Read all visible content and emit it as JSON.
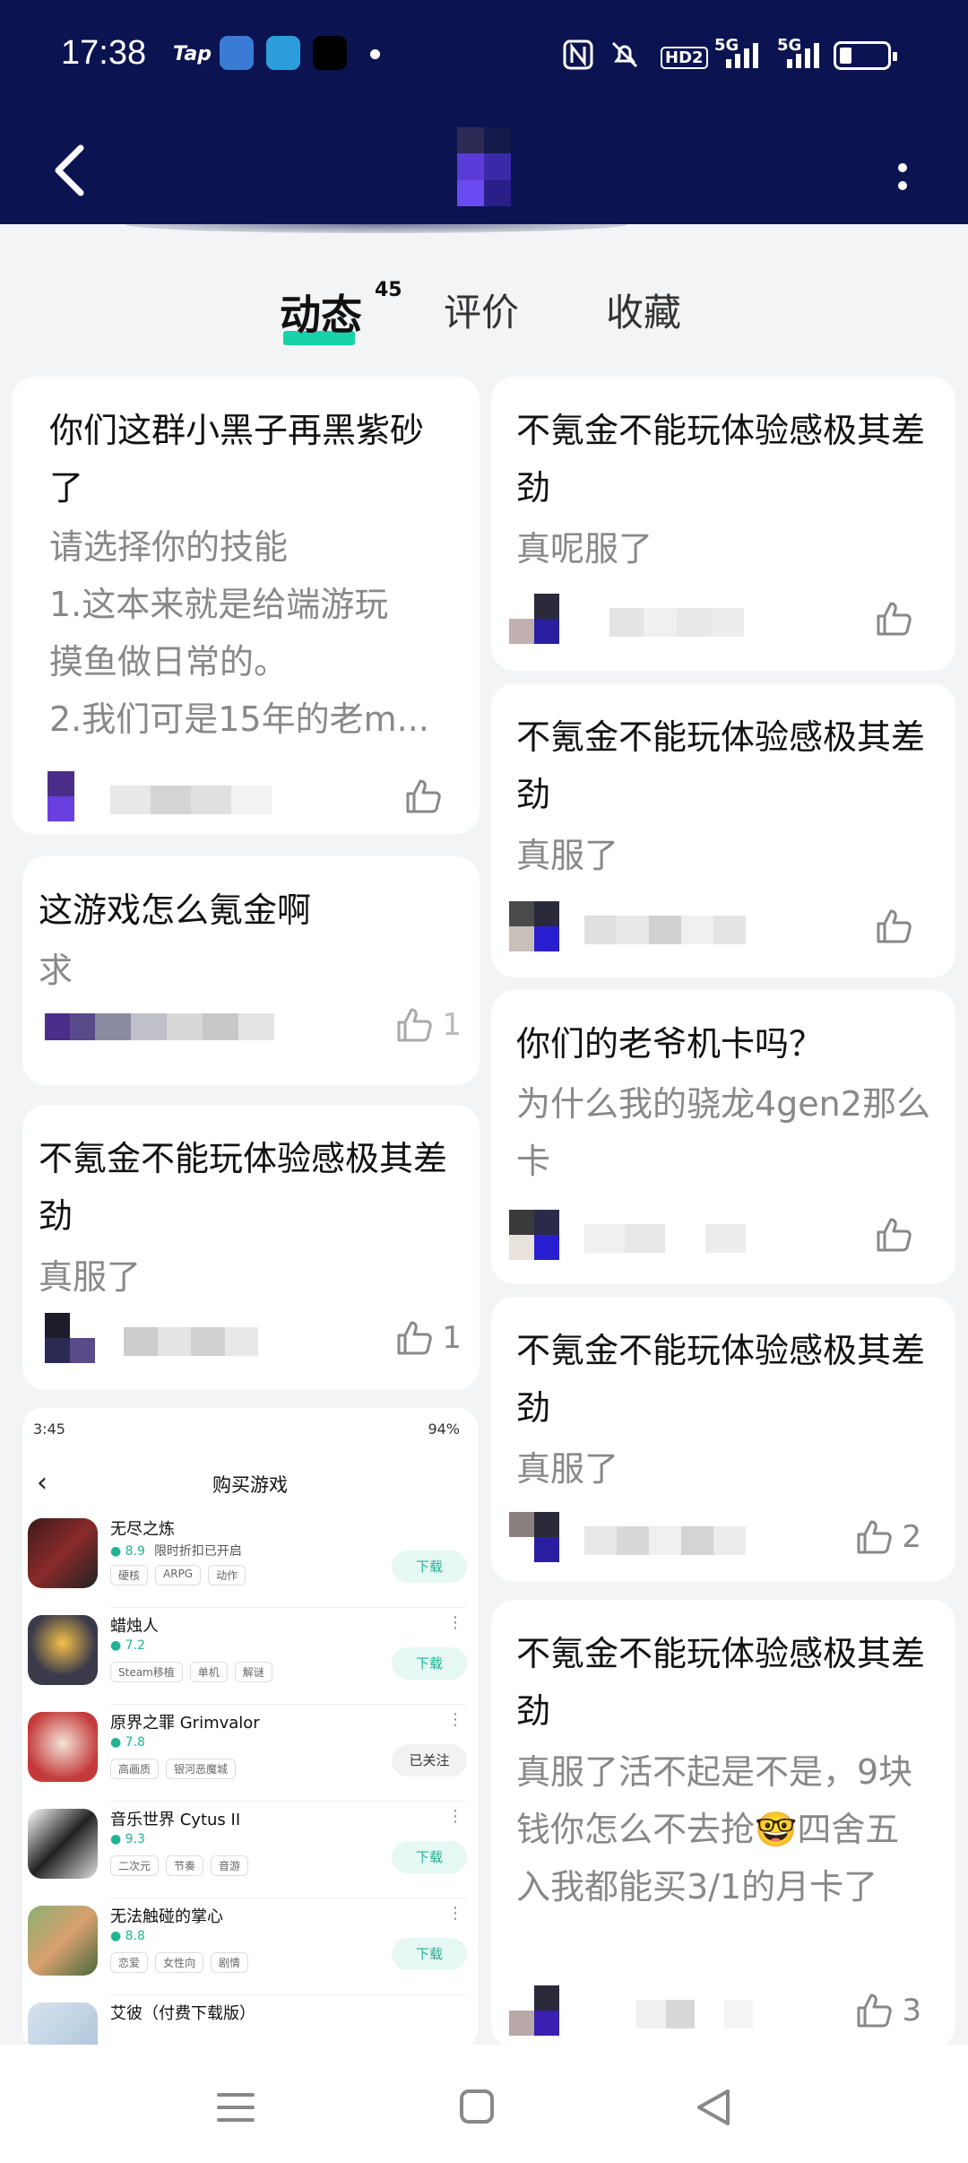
{
  "status_bar": {
    "time": "17:38",
    "tap_label": "Tap",
    "signal1_label": "5G",
    "signal2_label": "5G",
    "hd_label": "HD2"
  },
  "header": {
    "back_icon": "chevron-left-icon",
    "more_icon": "more-vertical-icon"
  },
  "tabs": [
    {
      "label": "动态",
      "badge": "45",
      "active": true
    },
    {
      "label": "评价",
      "active": false
    },
    {
      "label": "收藏",
      "active": false
    }
  ],
  "feed_left": [
    {
      "title": "你们这群小黑子再黑紫砂了",
      "body": "请选择你的技能\n1.这本来就是给端游玩\n摸鱼做日常的。\n2.我们可是15年的老m...",
      "likes": ""
    },
    {
      "title": "这游戏怎么氪金啊",
      "body": "求",
      "likes": "1"
    },
    {
      "title": "不氪金不能玩体验感极其差劲",
      "body": "真服了",
      "likes": "1"
    }
  ],
  "feed_right": [
    {
      "title": "不氪金不能玩体验感极其差劲",
      "body": "真呢服了",
      "likes": ""
    },
    {
      "title": "不氪金不能玩体验感极其差劲",
      "body": "真服了",
      "likes": ""
    },
    {
      "title": "你们的老爷机卡吗？",
      "body": "为什么我的骁龙4gen2那么卡",
      "likes": ""
    },
    {
      "title": "不氪金不能玩体验感极其差劲",
      "body": "真服了",
      "likes": "2"
    },
    {
      "title": "不氪金不能玩体验感极其差劲",
      "body": "真服了活不起是不是，9块钱你怎么不去抢🤓四舍五入我都能买3/1的月卡了",
      "likes": "3"
    }
  ],
  "screenshot_card": {
    "time": "3:45",
    "battery": "94%",
    "title": "购买游戏",
    "games": [
      {
        "name": "无尽之炼",
        "score": "8.9",
        "extra": "限时折扣已开启",
        "tags": [
          "硬核",
          "ARPG",
          "动作"
        ],
        "action": "下载"
      },
      {
        "name": "蜡烛人",
        "score": "7.2",
        "extra": "",
        "tags": [
          "Steam移植",
          "单机",
          "解谜"
        ],
        "action": "下载"
      },
      {
        "name": "原界之罪 Grimvalor",
        "score": "7.8",
        "extra": "",
        "tags": [
          "高画质",
          "银河恶魔城"
        ],
        "action": "已关注"
      },
      {
        "name": "音乐世界 Cytus II",
        "score": "9.3",
        "extra": "",
        "tags": [
          "二次元",
          "节奏",
          "音游"
        ],
        "action": "下载"
      },
      {
        "name": "无法触碰的掌心",
        "score": "8.8",
        "extra": "",
        "tags": [
          "恋爱",
          "女性向",
          "剧情"
        ],
        "action": "下载"
      },
      {
        "name": "艾彼（付费下载版）",
        "score": "",
        "extra": "",
        "tags": [],
        "action": ""
      }
    ]
  },
  "colors": {
    "header_bg": "#0b1450",
    "accent": "#19d1a8",
    "page_bg": "#f3f4f6"
  }
}
